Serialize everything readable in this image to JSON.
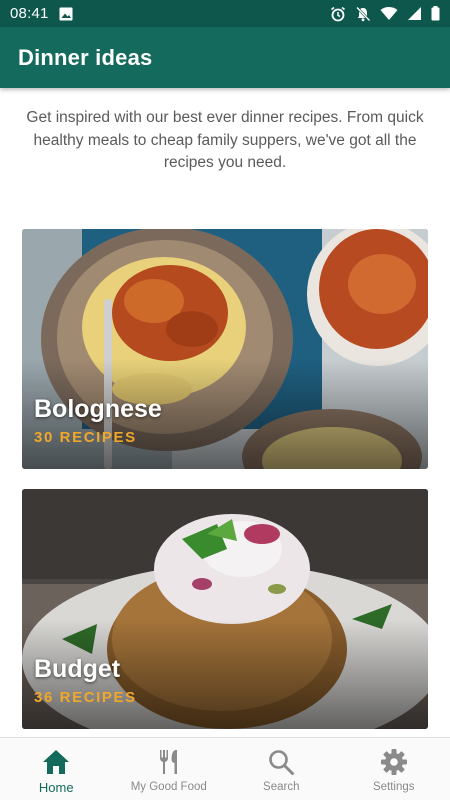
{
  "status_bar": {
    "time": "08:41",
    "icons": [
      "image-icon",
      "alarm-icon",
      "notifications-off-icon",
      "wifi-icon",
      "signal-icon",
      "battery-icon"
    ]
  },
  "app_bar": {
    "title": "Dinner ideas"
  },
  "intro": {
    "text": "Get inspired with our best ever dinner recipes. From quick healthy meals to cheap family suppers, we've got all the recipes you need."
  },
  "cards": [
    {
      "title": "Bolognese",
      "count": "30 RECIPES"
    },
    {
      "title": "Budget",
      "count": "36 RECIPES"
    }
  ],
  "bottom_nav": {
    "items": [
      {
        "label": "Home",
        "icon": "home-icon",
        "active": true
      },
      {
        "label": "My Good Food",
        "icon": "cutlery-icon",
        "active": false
      },
      {
        "label": "Search",
        "icon": "search-icon",
        "active": false
      },
      {
        "label": "Settings",
        "icon": "gear-icon",
        "active": false
      }
    ]
  },
  "colors": {
    "app_bar": "#146b5d",
    "status_bar": "#0e574c",
    "accent_count": "#f0a72a",
    "nav_active": "#146b5d",
    "nav_inactive": "#8a8a8a"
  }
}
